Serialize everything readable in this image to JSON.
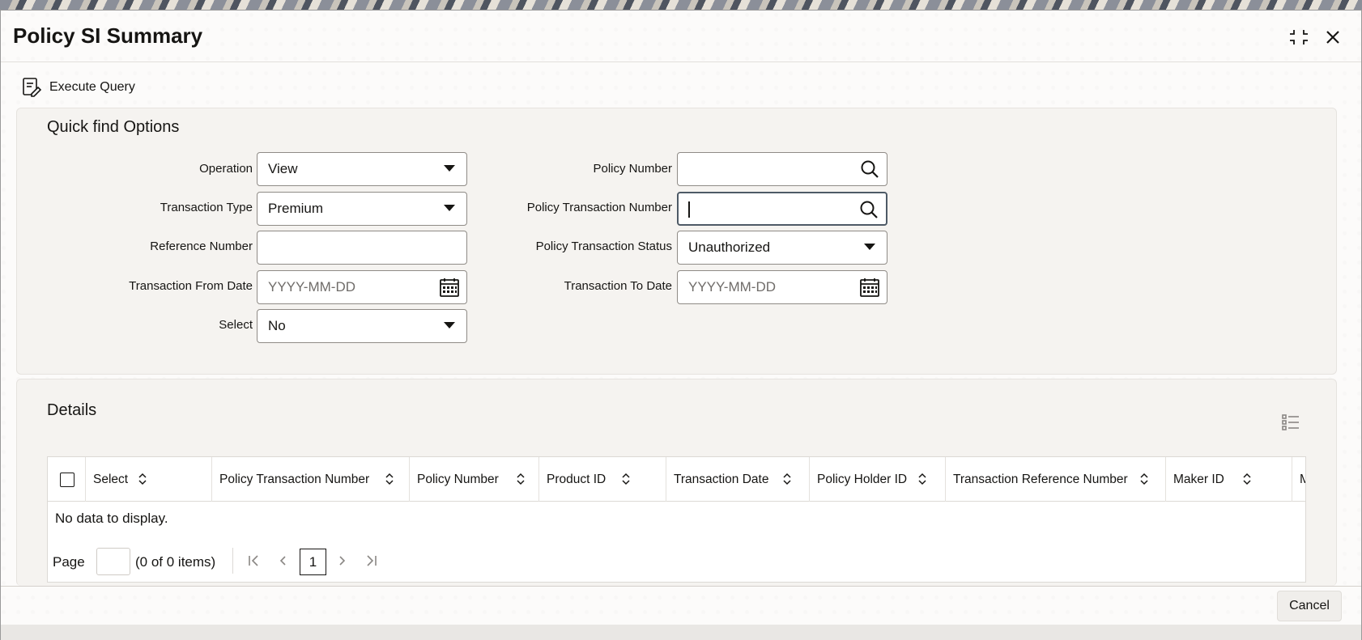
{
  "window": {
    "title": "Policy SI Summary"
  },
  "toolbar": {
    "execute_query_label": "Execute Query"
  },
  "quick_find": {
    "title": "Quick find Options",
    "operation": {
      "label": "Operation",
      "value": "View"
    },
    "transaction_type": {
      "label": "Transaction Type",
      "value": "Premium"
    },
    "reference_number": {
      "label": "Reference Number",
      "value": ""
    },
    "transaction_from_date": {
      "label": "Transaction From Date",
      "placeholder": "YYYY-MM-DD"
    },
    "select": {
      "label": "Select",
      "value": "No"
    },
    "policy_number": {
      "label": "Policy Number",
      "value": ""
    },
    "policy_transaction_number": {
      "label": "Policy Transaction Number",
      "value": ""
    },
    "policy_transaction_status": {
      "label": "Policy Transaction Status",
      "value": "Unauthorized"
    },
    "transaction_to_date": {
      "label": "Transaction To Date",
      "placeholder": "YYYY-MM-DD"
    }
  },
  "details": {
    "title": "Details",
    "columns": [
      "Select",
      "Policy Transaction Number",
      "Policy Number",
      "Product ID",
      "Transaction Date",
      "Policy Holder ID",
      "Transaction Reference Number",
      "Maker ID",
      "M"
    ],
    "empty_message": "No data to display.",
    "pager": {
      "label": "Page",
      "count_text": "(0 of 0 items)",
      "current_page": "1"
    }
  },
  "footer": {
    "cancel_label": "Cancel"
  },
  "colors": {
    "border": "#8f8b86",
    "text": "#161513",
    "panel": "#f5f3f0"
  }
}
